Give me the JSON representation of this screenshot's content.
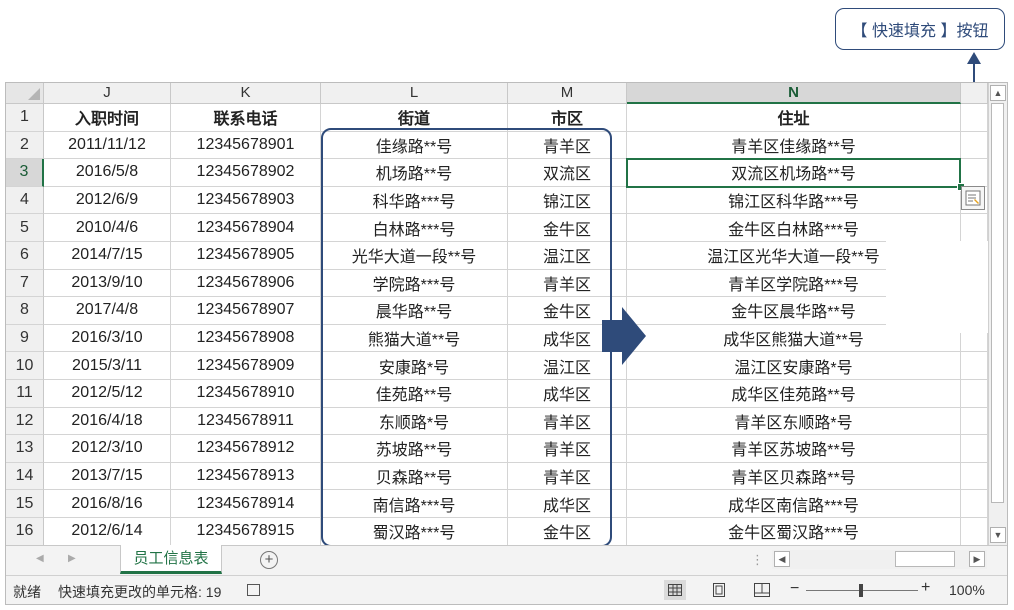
{
  "callout": {
    "label": "【 快速填充 】按钮"
  },
  "columns": [
    "J",
    "K",
    "L",
    "M",
    "N"
  ],
  "header_row": [
    "入职时间",
    "联系电话",
    "街道",
    "市区",
    "住址"
  ],
  "rows": [
    {
      "num": "1"
    },
    {
      "num": "2",
      "cells": [
        "2011/11/12",
        "12345678901",
        "佳缘路**号",
        "青羊区",
        "青羊区佳缘路**号"
      ]
    },
    {
      "num": "3",
      "cells": [
        "2016/5/8",
        "12345678902",
        "机场路**号",
        "双流区",
        "双流区机场路**号"
      ]
    },
    {
      "num": "4",
      "cells": [
        "2012/6/9",
        "12345678903",
        "科华路***号",
        "锦江区",
        "锦江区科华路***号"
      ]
    },
    {
      "num": "5",
      "cells": [
        "2010/4/6",
        "12345678904",
        "白林路***号",
        "金牛区",
        "金牛区白林路***号"
      ]
    },
    {
      "num": "6",
      "cells": [
        "2014/7/15",
        "12345678905",
        "光华大道一段**号",
        "温江区",
        "温江区光华大道一段**号"
      ]
    },
    {
      "num": "7",
      "cells": [
        "2013/9/10",
        "12345678906",
        "学院路***号",
        "青羊区",
        "青羊区学院路***号"
      ]
    },
    {
      "num": "8",
      "cells": [
        "2017/4/8",
        "12345678907",
        "晨华路**号",
        "金牛区",
        "金牛区晨华路**号"
      ]
    },
    {
      "num": "9",
      "cells": [
        "2016/3/10",
        "12345678908",
        "熊猫大道**号",
        "成华区",
        "成华区熊猫大道**号"
      ]
    },
    {
      "num": "10",
      "cells": [
        "2015/3/11",
        "12345678909",
        "安康路*号",
        "温江区",
        "温江区安康路*号"
      ]
    },
    {
      "num": "11",
      "cells": [
        "2012/5/12",
        "12345678910",
        "佳苑路**号",
        "成华区",
        "成华区佳苑路**号"
      ]
    },
    {
      "num": "12",
      "cells": [
        "2016/4/18",
        "12345678911",
        "东顺路*号",
        "青羊区",
        "青羊区东顺路*号"
      ]
    },
    {
      "num": "13",
      "cells": [
        "2012/3/10",
        "12345678912",
        "苏坡路**号",
        "青羊区",
        "青羊区苏坡路**号"
      ]
    },
    {
      "num": "14",
      "cells": [
        "2013/7/15",
        "12345678913",
        "贝森路**号",
        "青羊区",
        "青羊区贝森路**号"
      ]
    },
    {
      "num": "15",
      "cells": [
        "2016/8/16",
        "12345678914",
        "南信路***号",
        "成华区",
        "成华区南信路***号"
      ]
    },
    {
      "num": "16",
      "cells": [
        "2012/6/14",
        "12345678915",
        "蜀汉路***号",
        "金牛区",
        "金牛区蜀汉路***号"
      ]
    }
  ],
  "sheet_tab": {
    "label": "员工信息表"
  },
  "status": {
    "ready": "就绪",
    "message": "快速填充更改的单元格: 19",
    "zoom": "100%"
  },
  "icons": [
    "quick-fill-options-icon",
    "add-sheet-icon",
    "macro-record-icon",
    "normal-view-icon",
    "page-layout-icon",
    "page-break-preview-icon"
  ],
  "colors": {
    "accent": "#217346",
    "annotation": "#2f4b7a"
  }
}
